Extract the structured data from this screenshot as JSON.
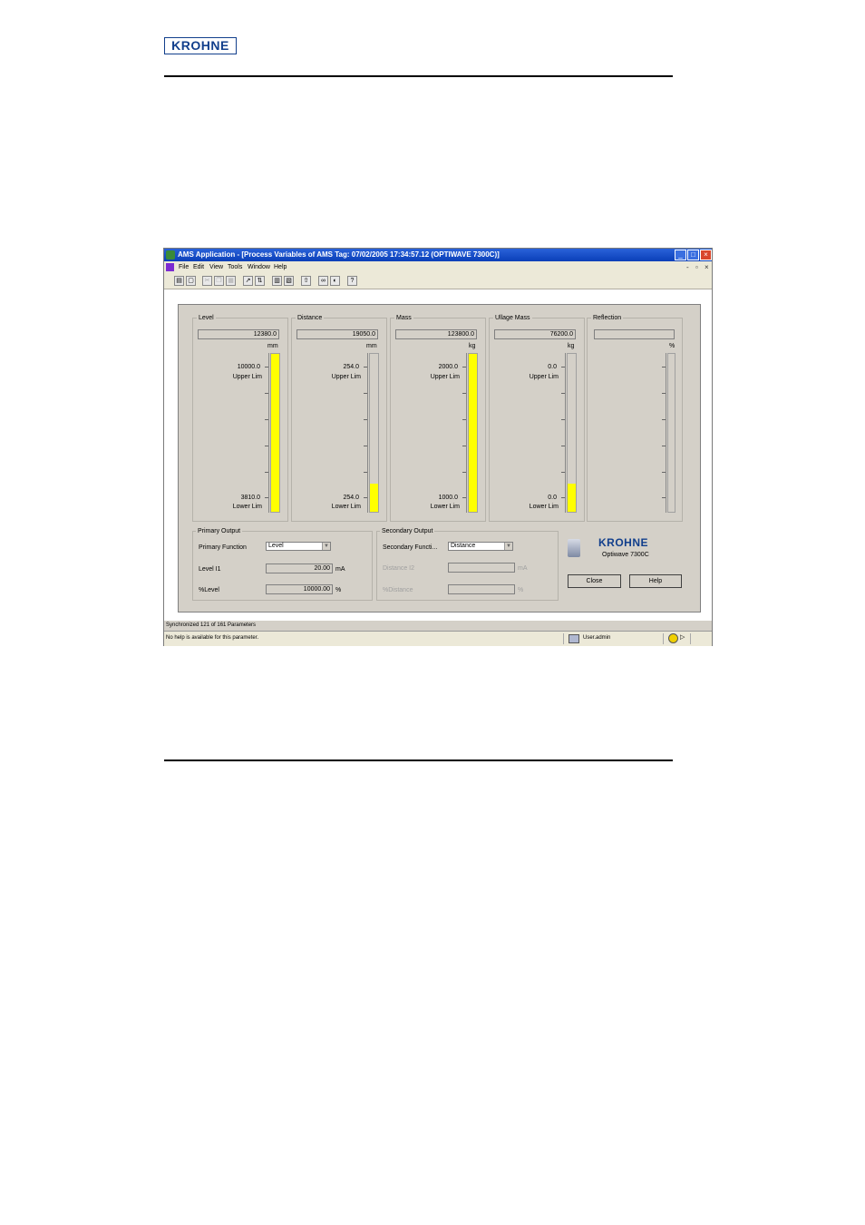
{
  "document": {
    "logo_text": "KROHNE"
  },
  "window": {
    "title": "AMS Application - [Process Variables of AMS Tag: 07/02/2005 17:34:57.12 (OPTIWAVE 7300C)]",
    "controls": {
      "minimize": "_",
      "maximize": "□",
      "close": "×"
    }
  },
  "menu": {
    "items": [
      "File",
      "Edit",
      "View",
      "Tools",
      "Window",
      "Help"
    ],
    "mdi_controls": [
      "-",
      "▫",
      "×"
    ]
  },
  "toolbar": {
    "buttons": [
      "print-icon",
      "print-preview-icon",
      "cut-icon",
      "copy-icon",
      "paste-icon",
      "connect-icon",
      "transfer-icon",
      "calendar-icon",
      "compare-icon",
      "upload-icon",
      "binoculars-icon",
      "diagnostics-icon",
      "context-help-icon"
    ]
  },
  "gauges": [
    {
      "label": "Level",
      "value": "12380.0",
      "unit": "mm",
      "upper": "10000.0",
      "upper_label": "Upper Lim",
      "lower": "3810.0",
      "lower_label": "Lower Lim",
      "fill_fraction": 1.0
    },
    {
      "label": "Distance",
      "value": "19050.0",
      "unit": "mm",
      "upper": "254.0",
      "upper_label": "Upper Lim",
      "lower": "254.0",
      "lower_label": "Lower Lim",
      "fill_fraction": 0.18
    },
    {
      "label": "Mass",
      "value": "123800.0",
      "unit": "kg",
      "upper": "2000.0",
      "upper_label": "Upper Lim",
      "lower": "1000.0",
      "lower_label": "Lower Lim",
      "fill_fraction": 1.0
    },
    {
      "label": "Ullage Mass",
      "value": "76200.0",
      "unit": "kg",
      "upper": "0.0",
      "upper_label": "Upper Lim",
      "lower": "0.0",
      "lower_label": "Lower Lim",
      "fill_fraction": 0.18
    },
    {
      "label": "Reflection",
      "value": "",
      "unit": "%",
      "upper": "",
      "upper_label": "",
      "lower": "",
      "lower_label": "",
      "fill_fraction": 0
    }
  ],
  "primary_output": {
    "title": "Primary Output",
    "function_label": "Primary Function",
    "function_value": "Level",
    "current_label": "Level I1",
    "current_value": "20.00",
    "current_unit": "mA",
    "percent_label": "%Level",
    "percent_value": "10000.00",
    "percent_unit": "%"
  },
  "secondary_output": {
    "title": "Secondary Output",
    "function_label": "Secondary Functi...",
    "function_value": "Distance",
    "current_label": "Distance I2",
    "current_value": "",
    "current_unit": "mA",
    "percent_label": "%Distance",
    "percent_value": "",
    "percent_unit": "%"
  },
  "device": {
    "brand": "KROHNE",
    "model": "Optiwave 7300C"
  },
  "buttons": {
    "close": "Close",
    "help": "Help"
  },
  "status": {
    "sync": "Synchronized 121 of 161 Parameters",
    "help": "No help is available for this parameter.",
    "user": "User.admin"
  },
  "colors": {
    "bar_fill": "#ffff00",
    "titlebar": "#0a3fb8",
    "brand": "#123f8c"
  }
}
